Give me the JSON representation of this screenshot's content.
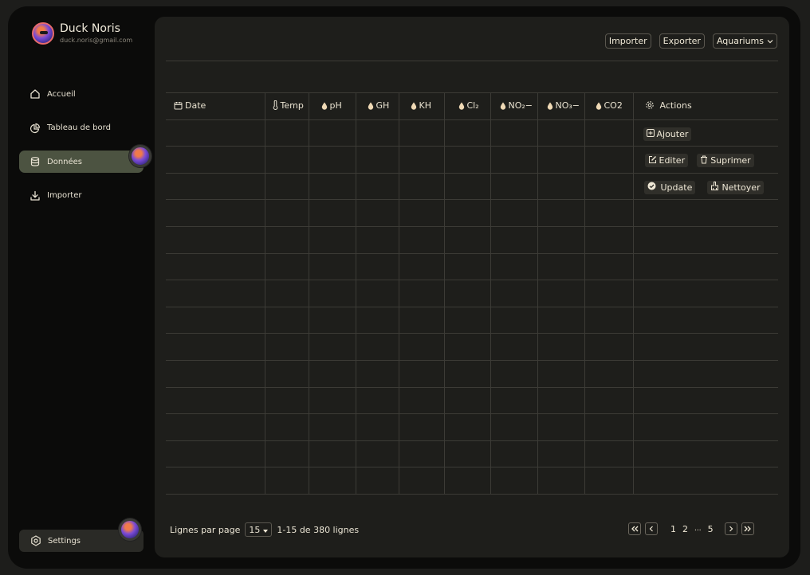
{
  "user": {
    "name": "Duck Noris",
    "email": "duck.noris@gmail.com"
  },
  "nav": [
    {
      "label": "Accueil",
      "icon": "home-icon",
      "active": false
    },
    {
      "label": "Tableau de bord",
      "icon": "pie-chart-icon",
      "active": false
    },
    {
      "label": "Données",
      "icon": "database-icon",
      "active": true
    },
    {
      "label": "Importer",
      "icon": "download-icon",
      "active": false
    }
  ],
  "settings_label": "Settings",
  "toolbar": {
    "import_label": "Importer",
    "export_label": "Exporter",
    "aquariums_label": "Aquariums"
  },
  "table": {
    "columns": [
      "Date",
      "Temp",
      "pH",
      "GH",
      "KH",
      "Cl₂",
      "NO₂−",
      "NO₃−",
      "CO2",
      "Actions"
    ],
    "actions": {
      "add_label": "Ajouter",
      "edit_label": "Editer",
      "delete_label": "Suprimer",
      "update_label": "Update",
      "clean_label": "Nettoyer"
    }
  },
  "footer": {
    "rows_per_page_label": "Lignes par page",
    "rows_per_page_value": "15",
    "range_text": "1-15 de 380 lignes",
    "pages": [
      "1",
      "2",
      "...",
      "5"
    ]
  },
  "colors": {
    "accent_active": "#4c5341",
    "panel": "#1e1e1b",
    "background": "#0b0b0a"
  }
}
